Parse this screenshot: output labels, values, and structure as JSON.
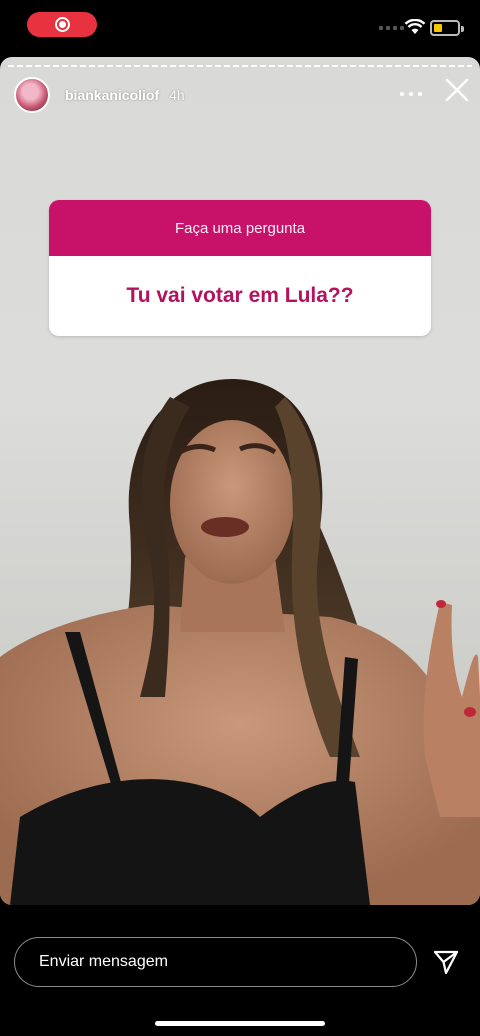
{
  "status_bar": {
    "recording_icon": "screen-record-icon",
    "wifi_icon": "wifi-icon",
    "battery_icon": "battery-icon",
    "battery_color": "#f5c800"
  },
  "story": {
    "username": "biankanicoliof",
    "time": "4h",
    "more_icon": "more-horizontal-icon",
    "close_icon": "close-icon"
  },
  "question_sticker": {
    "prompt": "Faça uma pergunta",
    "question": "Tu vai votar em Lula??",
    "accent_color": "#c8126a"
  },
  "reply": {
    "placeholder": "Enviar mensagem",
    "send_icon": "send-icon"
  }
}
